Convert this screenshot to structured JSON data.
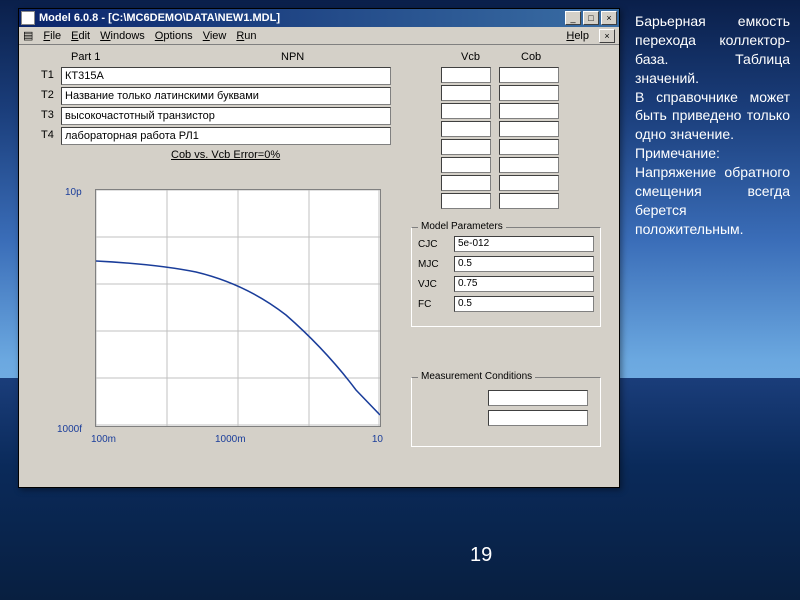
{
  "window": {
    "title": "Model 6.0.8 - [C:\\MC6DEMO\\DATA\\NEW1.MDL]",
    "btn_min": "_",
    "btn_max": "□",
    "btn_close": "×",
    "mdi_close": "×"
  },
  "menu": {
    "file": "File",
    "edit": "Edit",
    "windows": "Windows",
    "options": "Options",
    "view": "View",
    "run": "Run",
    "help": "Help"
  },
  "header": {
    "part": "Part 1",
    "type": "NPN",
    "vcb": "Vcb",
    "cob": "Cob"
  },
  "rows": {
    "t1": "T1",
    "t2": "T2",
    "t3": "T3",
    "t4": "T4",
    "v1": "КТ315А",
    "v2": "Название только латинскими буквами",
    "v3": "высокочастотный транзистор",
    "v4": "лабораторная работа РЛ1"
  },
  "chart_caption": "Cob vs. Vcb Error=0%",
  "chart_data": {
    "type": "line",
    "title": "",
    "xlabel": "",
    "ylabel": "",
    "x_ticks": [
      "100m",
      "1000m",
      "10"
    ],
    "y_ticks": [
      "10p",
      "1000f"
    ],
    "xlim": [
      0.1,
      10
    ],
    "ylim": [
      1e-12,
      1e-11
    ],
    "xscale": "log",
    "yscale": "log",
    "series": [
      {
        "name": "Cob",
        "x": [
          0.1,
          0.3,
          0.6,
          1.0,
          2.0,
          4.0,
          7.0,
          10.0
        ],
        "y": [
          5e-12,
          4.6e-12,
          4.2e-12,
          3.7e-12,
          3e-12,
          2.3e-12,
          1.7e-12,
          1.4e-12
        ]
      }
    ]
  },
  "model_params": {
    "legend": "Model Parameters",
    "rows": [
      {
        "label": "CJC",
        "value": "5e-012"
      },
      {
        "label": "MJC",
        "value": "0.5"
      },
      {
        "label": "VJC",
        "value": "0.75"
      },
      {
        "label": "FC",
        "value": "0.5"
      }
    ]
  },
  "measurement": {
    "legend": "Measurement Conditions"
  },
  "axis": {
    "y_top": "10p",
    "y_bot": "1000f",
    "x0": "100m",
    "x1": "1000m",
    "x2": "10"
  },
  "side_text": "Барьерная емкость перехода коллектор-база. Таблица значений.\nВ справочнике может быть приведено только одно значение.\nПримечание: Напряжение обратного смещения всегда берется положительным.",
  "slide_num": "19"
}
